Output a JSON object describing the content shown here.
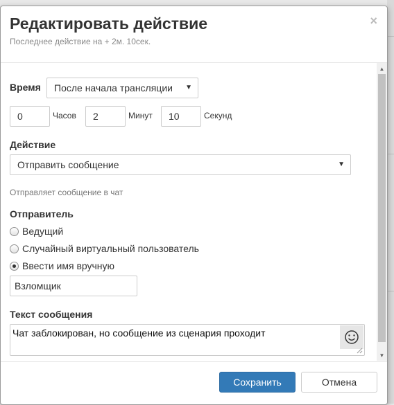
{
  "dialog": {
    "title": "Редактировать действие",
    "subtitle": "Последнее действие на + 2м. 10сек.",
    "close": "×"
  },
  "time": {
    "label": "Время",
    "mode": "После начала трансляции",
    "hours_value": "0",
    "hours_label": "Часов",
    "minutes_value": "2",
    "minutes_label": "Минут",
    "seconds_value": "10",
    "seconds_label": "Секунд"
  },
  "action": {
    "label": "Действие",
    "value": "Отправить сообщение",
    "hint": "Отправляет сообщение в чат"
  },
  "sender": {
    "label": "Отправитель",
    "options": [
      {
        "label": "Ведущий",
        "checked": false
      },
      {
        "label": "Случайный виртуальный пользователь",
        "checked": false
      },
      {
        "label": "Ввести имя вручную",
        "checked": true
      }
    ],
    "name_value": "Взломщик"
  },
  "message": {
    "label": "Текст сообщения",
    "value": "Чат заблокирован, но сообщение из сценария проходит",
    "emoji_icon": "smiley-icon"
  },
  "footer": {
    "save_label": "Сохранить",
    "cancel_label": "Отмена",
    "primary_color": "#337ab7"
  }
}
